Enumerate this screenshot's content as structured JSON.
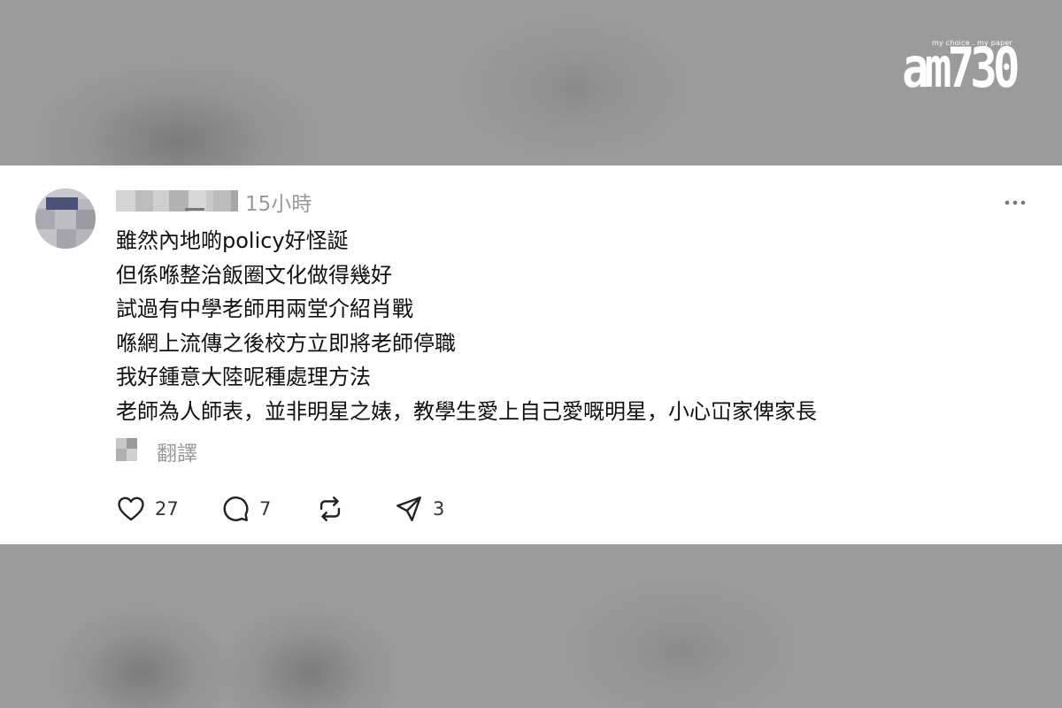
{
  "watermark": {
    "brand": "am730",
    "tagline": "my choice . my paper"
  },
  "post": {
    "timestamp": "15小時",
    "lines": [
      "雖然內地啲policy好怪誕",
      "但係喺整治飯圈文化做得幾好",
      "試過有中學老師用兩堂介紹肖戰",
      "喺網上流傳之後校方立即將老師停職",
      "我好鍾意大陸呢種處理方法",
      "老師為人師表，並非明星之婊，教學生愛上自己愛嘅明星，小心冚家俾家長"
    ],
    "translate_label": "翻譯",
    "more_icon": "more-horizontal-icon"
  },
  "actions": {
    "like": {
      "icon": "heart-icon",
      "count": "27"
    },
    "comment": {
      "icon": "comment-icon",
      "count": "7"
    },
    "repost": {
      "icon": "repost-icon",
      "count": ""
    },
    "share": {
      "icon": "send-icon",
      "count": "3"
    }
  },
  "colors": {
    "background": "#9b9b9b",
    "card": "#ffffff",
    "text": "#111111",
    "muted": "#999999"
  }
}
